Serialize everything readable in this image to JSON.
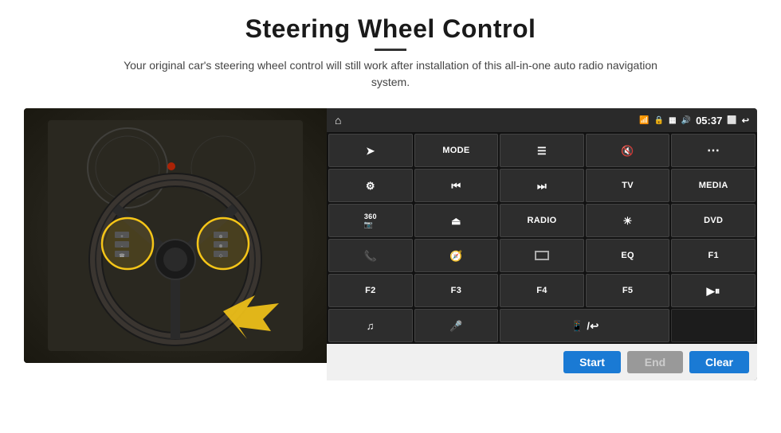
{
  "header": {
    "title": "Steering Wheel Control",
    "divider": true,
    "subtitle": "Your original car's steering wheel control will still work after installation of this all-in-one auto radio navigation system."
  },
  "status_bar": {
    "home_icon": "⌂",
    "wifi_icon": "WiFi",
    "lock_icon": "🔒",
    "sim_icon": "SIM",
    "bt_icon": "BT",
    "time": "05:37",
    "screen_icon": "⬜",
    "back_icon": "↩"
  },
  "grid_buttons": [
    {
      "id": "nav",
      "label": "➤",
      "type": "icon"
    },
    {
      "id": "mode",
      "label": "MODE",
      "type": "text"
    },
    {
      "id": "menu",
      "label": "☰",
      "type": "icon"
    },
    {
      "id": "mute",
      "label": "🔇",
      "type": "icon"
    },
    {
      "id": "apps",
      "label": "⋯",
      "type": "icon"
    },
    {
      "id": "settings",
      "label": "⚙",
      "type": "icon"
    },
    {
      "id": "prev",
      "label": "⏮",
      "type": "icon"
    },
    {
      "id": "next",
      "label": "⏭",
      "type": "icon"
    },
    {
      "id": "tv",
      "label": "TV",
      "type": "text"
    },
    {
      "id": "media",
      "label": "MEDIA",
      "type": "text"
    },
    {
      "id": "cam360",
      "label": "360 📷",
      "type": "icon"
    },
    {
      "id": "eject",
      "label": "⏏",
      "type": "icon"
    },
    {
      "id": "radio",
      "label": "RADIO",
      "type": "text"
    },
    {
      "id": "brightness",
      "label": "☀",
      "type": "icon"
    },
    {
      "id": "dvd",
      "label": "DVD",
      "type": "text"
    },
    {
      "id": "phone",
      "label": "📞",
      "type": "icon"
    },
    {
      "id": "navi",
      "label": "🧭",
      "type": "icon"
    },
    {
      "id": "screen_switch",
      "label": "⬜",
      "type": "icon"
    },
    {
      "id": "eq",
      "label": "EQ",
      "type": "text"
    },
    {
      "id": "f1",
      "label": "F1",
      "type": "text"
    },
    {
      "id": "f2",
      "label": "F2",
      "type": "text"
    },
    {
      "id": "f3",
      "label": "F3",
      "type": "text"
    },
    {
      "id": "f4",
      "label": "F4",
      "type": "text"
    },
    {
      "id": "f5",
      "label": "F5",
      "type": "text"
    },
    {
      "id": "play_pause",
      "label": "▶⏸",
      "type": "icon"
    },
    {
      "id": "music",
      "label": "♫",
      "type": "icon"
    },
    {
      "id": "mic",
      "label": "🎤",
      "type": "icon"
    },
    {
      "id": "call",
      "label": "📱",
      "type": "icon",
      "span": 2
    }
  ],
  "action_bar": {
    "start_label": "Start",
    "end_label": "End",
    "clear_label": "Clear"
  }
}
